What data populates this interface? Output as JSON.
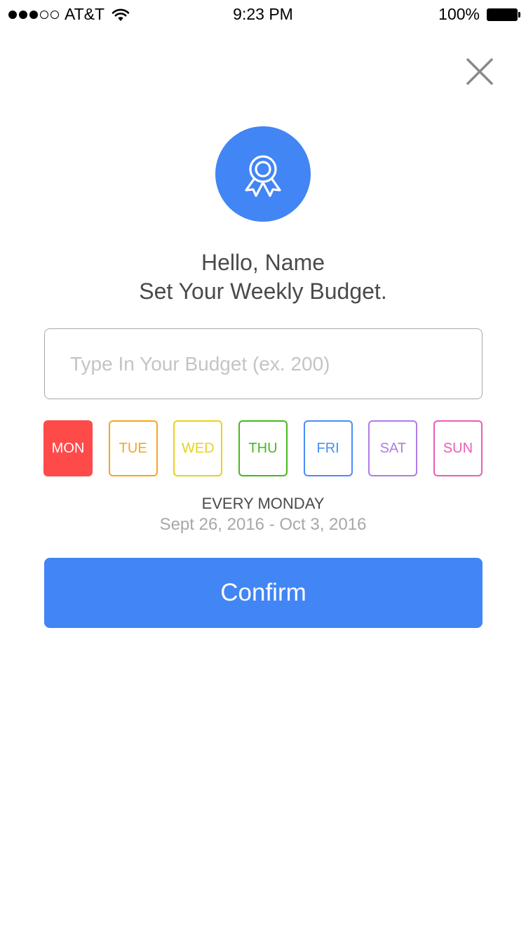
{
  "status_bar": {
    "carrier": "AT&T",
    "signal_bars_filled": 3,
    "signal_bars_total": 5,
    "time": "9:23 PM",
    "battery": "100%",
    "battery_level": 1.0,
    "icons": [
      "wifi-icon",
      "battery-icon"
    ]
  },
  "header": {
    "close_icon": "close-icon"
  },
  "badge": {
    "icon": "award-ribbon-icon",
    "color": "#4285f4"
  },
  "greeting": {
    "line1": "Hello, Name",
    "line2": "Set Your Weekly Budget."
  },
  "budget_input": {
    "value": "",
    "placeholder": "Type In Your Budget (ex. 200)"
  },
  "days": [
    {
      "label": "MON",
      "color": "#ff4a4a",
      "selected": true
    },
    {
      "label": "TUE",
      "color": "#f5a623",
      "selected": false
    },
    {
      "label": "WED",
      "color": "#e8d21a",
      "selected": false
    },
    {
      "label": "THU",
      "color": "#48b81f",
      "selected": false
    },
    {
      "label": "FRI",
      "color": "#4a8ef5",
      "selected": false
    },
    {
      "label": "SAT",
      "color": "#b07be8",
      "selected": false
    },
    {
      "label": "SUN",
      "color": "#ec5bb7",
      "selected": false
    }
  ],
  "schedule": {
    "title": "EVERY MONDAY",
    "range": "Sept 26, 2016 - Oct 3, 2016"
  },
  "confirm": {
    "label": "Confirm",
    "color": "#4285f4"
  }
}
